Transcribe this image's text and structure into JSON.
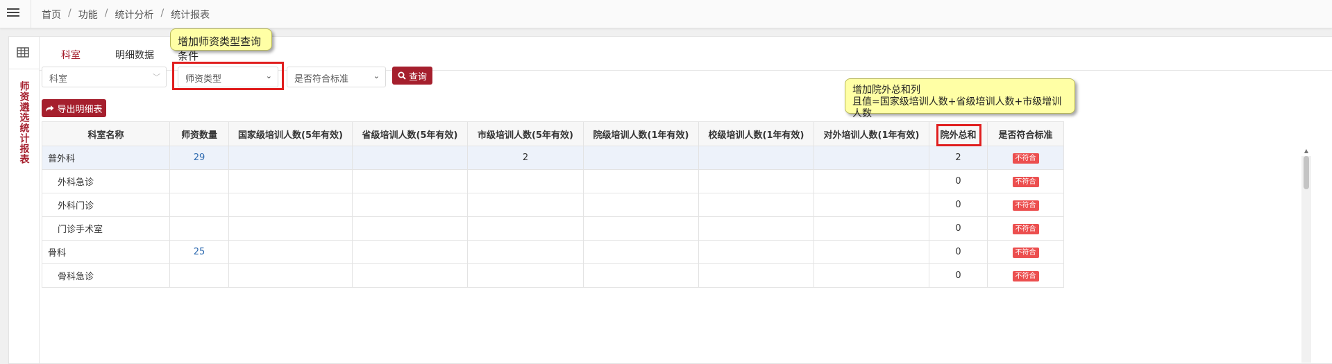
{
  "breadcrumb": [
    "首页",
    "功能",
    "统计分析",
    "统计报表"
  ],
  "sidebar_title": "师资遴选统计报表",
  "tabs": [
    "科室",
    "明细数据"
  ],
  "filters": {
    "dept_placeholder": "科室",
    "teacher_type": "师资类型",
    "meets_standard": "是否符合标准"
  },
  "buttons": {
    "query": "查询",
    "export": "导出明细表"
  },
  "notes": {
    "note1": "增加师资类型查询条件",
    "note2_line1": "增加院外总和列",
    "note2_line2": "且值=国家级培训人数+省级培训人数+市级增训人数"
  },
  "table": {
    "headers": [
      "科室名称",
      "师资数量",
      "国家级培训人数(5年有效)",
      "省级培训人数(5年有效)",
      "市级培训人数(5年有效)",
      "院级培训人数(1年有效)",
      "校级培训人数(1年有效)",
      "对外培训人数(1年有效)",
      "院外总和",
      "是否符合标准"
    ],
    "rows": [
      {
        "name": "普外科",
        "count": "29",
        "national": "",
        "provincial": "",
        "city": "2",
        "hospital": "",
        "school": "",
        "external": "",
        "outside_total": "2",
        "status": "不符合"
      },
      {
        "name": "外科急诊",
        "count": "",
        "national": "",
        "provincial": "",
        "city": "",
        "hospital": "",
        "school": "",
        "external": "",
        "outside_total": "0",
        "status": "不符合"
      },
      {
        "name": "外科门诊",
        "count": "",
        "national": "",
        "provincial": "",
        "city": "",
        "hospital": "",
        "school": "",
        "external": "",
        "outside_total": "0",
        "status": "不符合"
      },
      {
        "name": "门诊手术室",
        "count": "",
        "national": "",
        "provincial": "",
        "city": "",
        "hospital": "",
        "school": "",
        "external": "",
        "outside_total": "0",
        "status": "不符合"
      },
      {
        "name": "骨科",
        "count": "25",
        "national": "",
        "provincial": "",
        "city": "",
        "hospital": "",
        "school": "",
        "external": "",
        "outside_total": "0",
        "status": "不符合"
      },
      {
        "name": "骨科急诊",
        "count": "",
        "national": "",
        "provincial": "",
        "city": "",
        "hospital": "",
        "school": "",
        "external": "",
        "outside_total": "0",
        "status": "不符合"
      }
    ]
  },
  "colors": {
    "accent": "#a51f2d",
    "badge": "#ec4f4f",
    "link": "#2f6bb0",
    "highlight_row": "#edf2fa"
  }
}
